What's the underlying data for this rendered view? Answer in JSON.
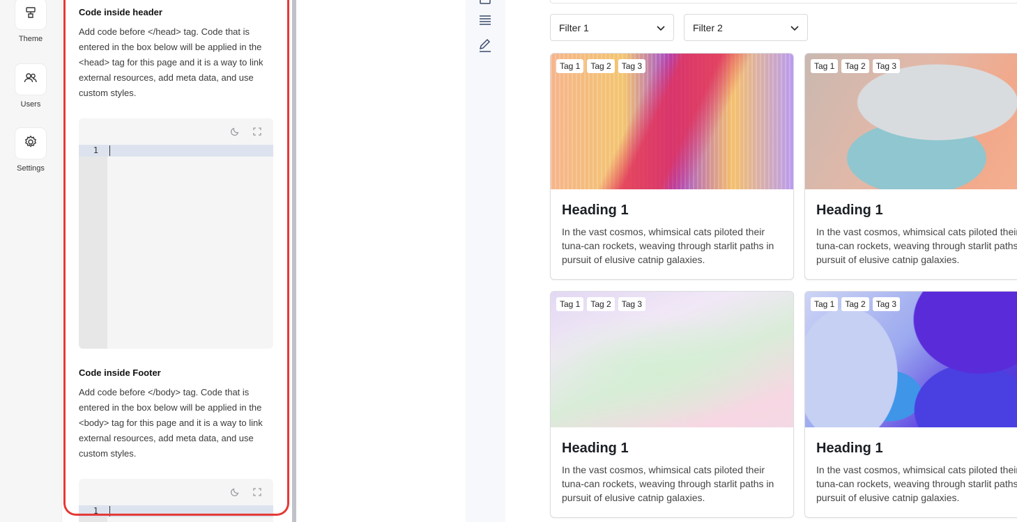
{
  "rail": {
    "items": [
      {
        "label": "Theme",
        "icon": "paint-roller-icon"
      },
      {
        "label": "Users",
        "icon": "users-icon"
      },
      {
        "label": "Settings",
        "icon": "gear-icon"
      }
    ]
  },
  "panel": {
    "header_section": {
      "title": "Code inside header",
      "description": "Add code before </head> tag. Code that is entered in the box below will be applied in the <head> tag for this page and it is a way to link external resources, add meta data, and use custom styles.",
      "line_number": "1"
    },
    "footer_section": {
      "title": "Code inside Footer",
      "description": "Add code before </body> tag. Code that is entered in the box below will be applied in the <body> tag for this page and it is a way to link external resources, add meta data, and use custom styles.",
      "line_number": "1"
    }
  },
  "main": {
    "filters": [
      {
        "label": "Filter 1"
      },
      {
        "label": "Filter 2"
      }
    ],
    "cards": [
      {
        "tags": [
          "Tag 1",
          "Tag 2",
          "Tag 3"
        ],
        "heading": "Heading 1",
        "text": "In the vast cosmos, whimsical cats piloted their tuna-can rockets, weaving through starlit paths in pursuit of elusive catnip galaxies."
      },
      {
        "tags": [
          "Tag 1",
          "Tag 2",
          "Tag 3"
        ],
        "heading": "Heading 1",
        "text": "In the vast cosmos, whimsical cats piloted their tuna-can rockets, weaving through starlit paths in pursuit of elusive catnip galaxies."
      },
      {
        "tags": [
          "Tag 1",
          "Tag 2",
          "Tag 3"
        ],
        "heading": "Heading 1",
        "text": "In the vast cosmos, whimsical cats piloted their tuna-can rockets, weaving through starlit paths in pursuit of elusive catnip galaxies."
      },
      {
        "tags": [
          "Tag 1",
          "Tag 2",
          "Tag 3"
        ],
        "heading": "Heading 1",
        "text": "In the vast cosmos, whimsical cats piloted their tuna-can rockets, weaving through starlit paths in pursuit of elusive catnip galaxies."
      }
    ]
  },
  "colors": {
    "highlight": "#e53935",
    "accent_line": "#dde3ee"
  }
}
